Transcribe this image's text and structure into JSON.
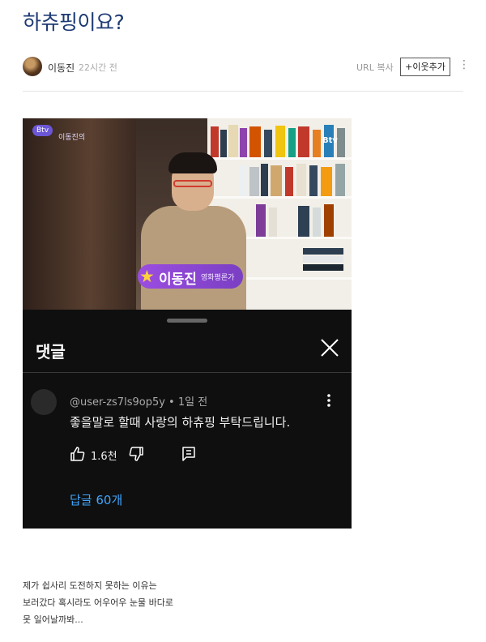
{
  "post": {
    "title": "하츄핑이요?",
    "author": "이동진",
    "time": "22시간 전",
    "url_copy": "URL 복사",
    "add_neighbor": "+이웃추가",
    "more": "⋮"
  },
  "video": {
    "channel_logo": "Btv",
    "channel_title": "이동진의",
    "corner_logo": "Btv",
    "caption_name": "이동진",
    "caption_role": "영화평론가"
  },
  "comments": {
    "title": "댓글",
    "comment": {
      "username": "@user-zs7ls9op5y • 1일 전",
      "text": "좋을말로 할때 사랑의 하츄핑 부탁드립니다.",
      "likes": "1.6천",
      "replies": "답글 60개"
    }
  },
  "body": {
    "lines": [
      "제가 쉽사리 도전하지 못하는 이유는",
      "보러갔다 혹시라도 어우어우 눈물 바다로",
      "못 일어날까봐..."
    ]
  },
  "colors": {
    "title": "#1e3a73",
    "reply_link": "#3ea6ff",
    "nameplate": "#9b4de0"
  }
}
